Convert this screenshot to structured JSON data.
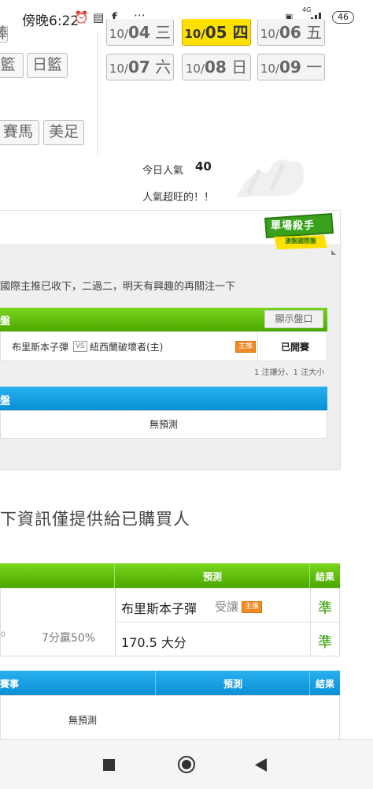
{
  "status_bar": {
    "time": "傍晚6:22",
    "battery": "46",
    "net": "4G"
  },
  "dates": {
    "row1": [
      {
        "prefix": "10/",
        "day": "04",
        "weekday": "三",
        "active": false
      },
      {
        "prefix": "10/",
        "day": "05",
        "weekday": "四",
        "active": true
      },
      {
        "prefix": "10/",
        "day": "06",
        "weekday": "五",
        "active": false
      }
    ],
    "row2": [
      {
        "prefix": "10/",
        "day": "07",
        "weekday": "六"
      },
      {
        "prefix": "10/",
        "day": "08",
        "weekday": "日"
      },
      {
        "prefix": "10/",
        "day": "09",
        "weekday": "一"
      }
    ]
  },
  "sports": {
    "row0_partial": "棒",
    "row1": [
      "籃",
      "日籃"
    ],
    "row2": [
      "賽馬",
      "美足"
    ]
  },
  "popularity": {
    "label": "今日人氣",
    "value": "40",
    "desc": "人氣超旺的！！"
  },
  "badge": {
    "title": "單場殺手",
    "subtitle": "澳盤國際盤"
  },
  "intro_text": "國際主推已收下，二過二，明天有興趣的再關注一下",
  "section_intl": {
    "title": "盤",
    "show_button": "顯示盤口",
    "home": "布里斯本子彈",
    "vs": "VS",
    "away": "紐西蘭破壞者(主)",
    "tag": "主推",
    "status": "已開賽",
    "note": "1 注讓分、1 注大小"
  },
  "section_blue": {
    "title": "盤",
    "no_prediction": "無預測"
  },
  "heading_purchased": "下資訊僅提供給已購買人",
  "result_table": {
    "col_predict": "預測",
    "col_result": "結果",
    "rows": [
      {
        "left_small": "",
        "left_mid": "",
        "prediction": "布里斯本子彈",
        "handicap": "受讓",
        "tag": "主推",
        "result": "準"
      },
      {
        "left_small": "0",
        "left_mid": "7分贏50%",
        "prediction": "170.5 大分",
        "handicap": "",
        "tag": "",
        "result": "準"
      }
    ]
  },
  "blue_table": {
    "col_event": "賽事",
    "col_predict": "預測",
    "col_result": "結果",
    "no_prediction": "無預測"
  }
}
